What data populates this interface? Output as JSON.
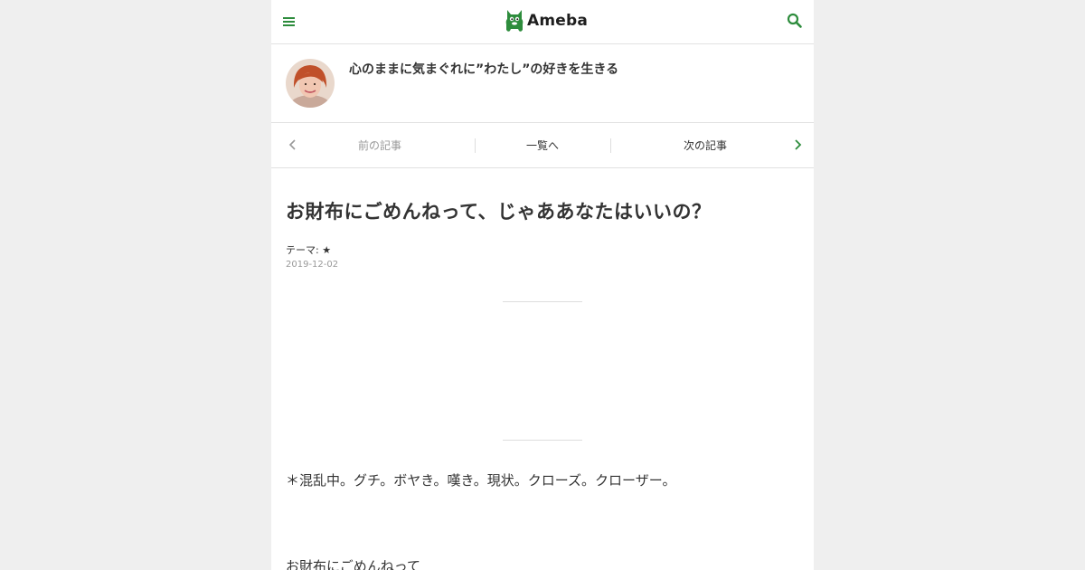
{
  "header": {
    "logo_text": "Ameba",
    "brand_color": "#2d8c3c",
    "menu_icon": "hamburger-menu-icon",
    "search_icon": "search-icon"
  },
  "blog": {
    "title": "心のままに気まぐれに”わたし”の好きを生きる",
    "avatar_icon": "profile-avatar"
  },
  "pager": {
    "prev_label": "前の記事",
    "list_label": "一覧へ",
    "next_label": "次の記事"
  },
  "article": {
    "title": "お財布にごめんねって、じゃああなたはいいの？",
    "theme_label": "テーマ:",
    "theme_value": "★",
    "date": "2019-12-02",
    "body_line_1": "＊混乱中。グチ。ボヤき。嘆き。現状。クローズ。クローザー。",
    "body_line_2": "お財布にごめんねって"
  }
}
